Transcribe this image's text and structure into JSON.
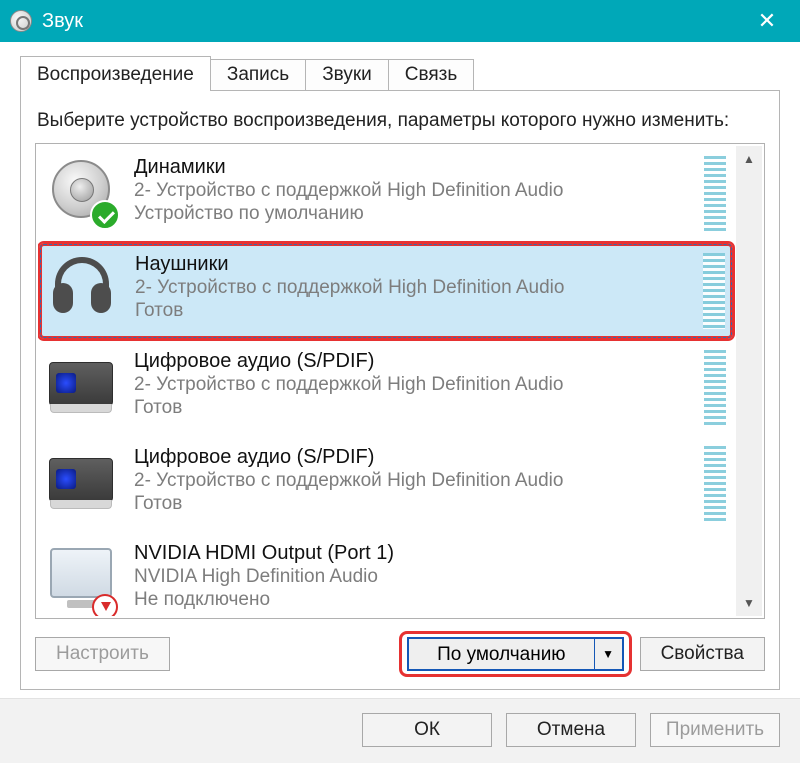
{
  "window": {
    "title": "Звук"
  },
  "tabs": [
    {
      "label": "Воспроизведение",
      "active": true
    },
    {
      "label": "Запись",
      "active": false
    },
    {
      "label": "Звуки",
      "active": false
    },
    {
      "label": "Связь",
      "active": false
    }
  ],
  "instruction": "Выберите устройство воспроизведения, параметры которого нужно изменить:",
  "devices": [
    {
      "name": "Динамики",
      "desc": "2- Устройство с поддержкой High Definition Audio",
      "status": "Устройство по умолчанию",
      "icon": "speaker",
      "default": true,
      "selected": false
    },
    {
      "name": "Наушники",
      "desc": "2- Устройство с поддержкой High Definition Audio",
      "status": "Готов",
      "icon": "headphones",
      "default": false,
      "selected": true
    },
    {
      "name": "Цифровое аудио (S/PDIF)",
      "desc": "2- Устройство с поддержкой High Definition Audio",
      "status": "Готов",
      "icon": "spdif",
      "default": false,
      "selected": false
    },
    {
      "name": "Цифровое аудио (S/PDIF)",
      "desc": "2- Устройство с поддержкой High Definition Audio",
      "status": "Готов",
      "icon": "spdif",
      "default": false,
      "selected": false
    },
    {
      "name": "NVIDIA HDMI Output (Port 1)",
      "desc": "NVIDIA High Definition Audio",
      "status": "Не подключено",
      "icon": "monitor",
      "default": false,
      "selected": false,
      "disconnected": true
    }
  ],
  "panel_buttons": {
    "configure": "Настроить",
    "set_default": "По умолчанию",
    "properties": "Свойства"
  },
  "dialog_buttons": {
    "ok": "ОК",
    "cancel": "Отмена",
    "apply": "Применить"
  },
  "colors": {
    "titlebar": "#00a8b8",
    "highlight": "#e63232",
    "selection": "#cce8f7"
  }
}
